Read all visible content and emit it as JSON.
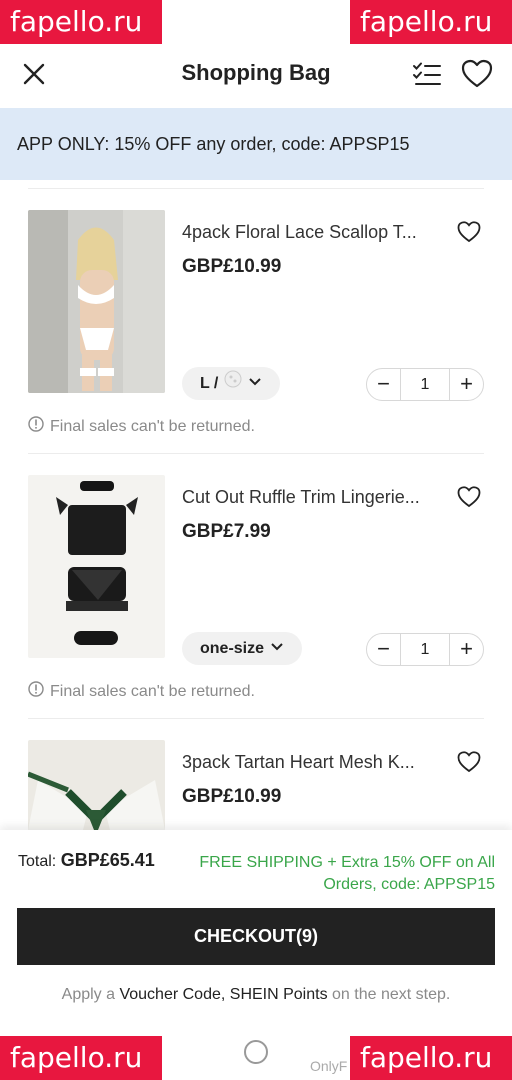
{
  "status_bar": {
    "icons": "… ◎ …"
  },
  "watermarks": {
    "tl": "fapello.ru",
    "tr": "fapello.ru",
    "bl": "fapello.ru",
    "br": "fapello.ru",
    "partial": "OnlyF"
  },
  "header": {
    "title": "Shopping Bag"
  },
  "banner": {
    "text": "APP ONLY: 15% OFF any order, code: APPSP15"
  },
  "items": [
    {
      "name": "4pack Floral Lace Scallop T...",
      "price": "GBP£10.99",
      "attr": "L /",
      "qty": "1",
      "notice": "Final sales can't be returned."
    },
    {
      "name": "Cut Out Ruffle Trim Lingerie...",
      "price": "GBP£7.99",
      "attr": "one-size",
      "qty": "1",
      "notice": "Final sales can't be returned."
    },
    {
      "name": "3pack Tartan Heart Mesh K...",
      "price": "GBP£10.99"
    }
  ],
  "footer": {
    "total_label": "Total:",
    "total_amount": "GBP£65.41",
    "promo": "FREE SHIPPING + Extra 15% OFF on All Orders, code: APPSP15",
    "checkout_label": "CHECKOUT(9)",
    "note_prefix": "Apply a",
    "note_highlight": "Voucher Code, SHEIN Points",
    "note_suffix": "on the next step."
  },
  "colors": {
    "banner": "#dde9f7",
    "promo_green": "#3aa64a",
    "checkout_bg": "#222222",
    "watermark": "#e8173f"
  }
}
